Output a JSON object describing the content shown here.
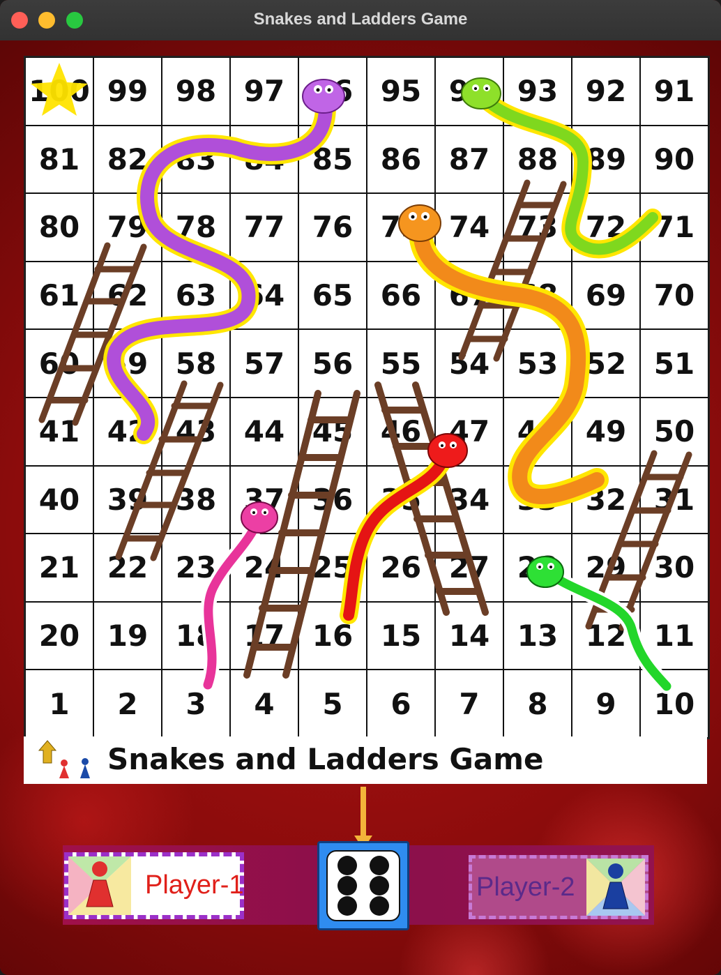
{
  "window": {
    "title": "Snakes and Ladders Game"
  },
  "board": {
    "rows": [
      [
        100,
        99,
        98,
        97,
        96,
        95,
        94,
        93,
        92,
        91
      ],
      [
        81,
        82,
        83,
        84,
        85,
        86,
        87,
        88,
        89,
        90
      ],
      [
        80,
        79,
        78,
        77,
        76,
        75,
        74,
        73,
        72,
        71
      ],
      [
        61,
        62,
        63,
        64,
        65,
        66,
        67,
        68,
        69,
        70
      ],
      [
        60,
        59,
        58,
        57,
        56,
        55,
        54,
        53,
        52,
        51
      ],
      [
        41,
        42,
        43,
        44,
        45,
        46,
        47,
        48,
        49,
        50
      ],
      [
        40,
        39,
        38,
        37,
        36,
        35,
        34,
        33,
        32,
        31
      ],
      [
        21,
        22,
        23,
        24,
        25,
        26,
        27,
        28,
        29,
        30
      ],
      [
        20,
        19,
        18,
        17,
        16,
        15,
        14,
        13,
        12,
        11
      ],
      [
        1,
        2,
        3,
        4,
        5,
        6,
        7,
        8,
        9,
        10
      ]
    ],
    "star_square": 100
  },
  "banner": {
    "text": "Snakes and Ladders Game"
  },
  "players": {
    "player1": {
      "label": "Player-1",
      "color": "#e0201a"
    },
    "player2": {
      "label": "Player-2",
      "color": "#5b2a8a"
    }
  },
  "dice": {
    "value": 6
  },
  "colors": {
    "ladder": "#6b3e26",
    "background": "#8c0c0c",
    "dice_frame": "#2f8cf0"
  }
}
